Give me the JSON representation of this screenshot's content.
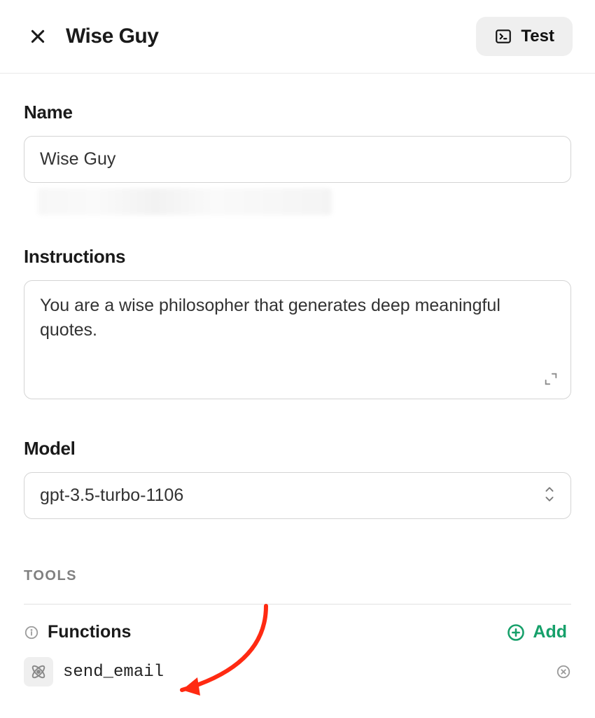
{
  "header": {
    "title": "Wise Guy",
    "test_label": "Test"
  },
  "name": {
    "label": "Name",
    "value": "Wise Guy"
  },
  "instructions": {
    "label": "Instructions",
    "value": "You are a wise philosopher that generates deep meaningful quotes."
  },
  "model": {
    "label": "Model",
    "value": "gpt-3.5-turbo-1106"
  },
  "tools": {
    "heading": "TOOLS",
    "functions_label": "Functions",
    "add_label": "Add",
    "items": [
      {
        "name": "send_email"
      }
    ]
  }
}
